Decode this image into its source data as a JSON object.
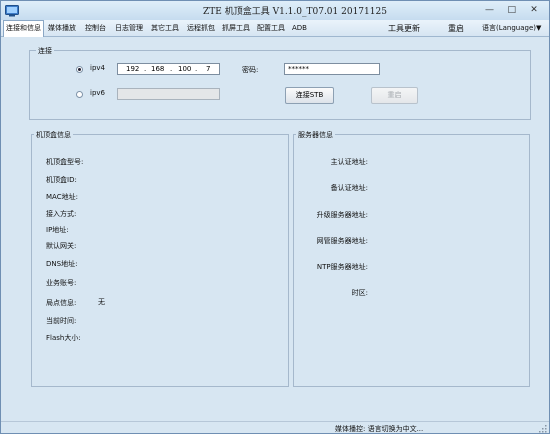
{
  "window": {
    "title": "ZTE 机顶盒工具 V1.1.0_T07.01 20171125",
    "icon": "app-icon",
    "controls": {
      "minimize": "—",
      "maximize": "□",
      "close": "✕"
    }
  },
  "menu": {
    "items": [
      "连接和信息",
      "媒体播放",
      "控制台",
      "日志管理",
      "其它工具",
      "远程抓包",
      "抓屏工具",
      "配置工具",
      "ADB"
    ],
    "active_index": 0,
    "right": {
      "update": "工具更新",
      "restart": "重启",
      "language": "语言(Language)▼"
    }
  },
  "connection": {
    "legend": "连接",
    "ipv4_label": "ipv4",
    "ipv4_selected": true,
    "ipv4_octets": [
      "192",
      "168",
      "100",
      "7"
    ],
    "password_label": "密码:",
    "password_value": "******",
    "ipv6_label": "ipv6",
    "ipv6_value": "",
    "connect_button": "连接STB",
    "restart_button": "重启"
  },
  "stb_info": {
    "legend": "机顶盒信息",
    "rows": [
      {
        "label": "机顶盒型号:",
        "value": ""
      },
      {
        "label": "机顶盒ID:",
        "value": ""
      },
      {
        "label": "MAC地址:",
        "value": ""
      },
      {
        "label": "接入方式:",
        "value": ""
      },
      {
        "label": "IP地址:",
        "value": ""
      },
      {
        "label": "默认网关:",
        "value": ""
      },
      {
        "label": "DNS地址:",
        "value": ""
      },
      {
        "label": "业务账号:",
        "value": ""
      },
      {
        "label": "局点信息:",
        "value": "无"
      },
      {
        "label": "当前时间:",
        "value": ""
      },
      {
        "label": "Flash大小:",
        "value": ""
      }
    ]
  },
  "server_info": {
    "legend": "服务器信息",
    "rows": [
      {
        "label": "主认证地址:",
        "value": ""
      },
      {
        "label": "备认证地址:",
        "value": ""
      },
      {
        "label": "升级服务器地址:",
        "value": ""
      },
      {
        "label": "网管服务器地址:",
        "value": ""
      },
      {
        "label": "NTP服务器地址:",
        "value": ""
      },
      {
        "label": "时区:",
        "value": ""
      }
    ]
  },
  "status_bar": {
    "text": "媒体播控: 语言切换为中文..."
  }
}
